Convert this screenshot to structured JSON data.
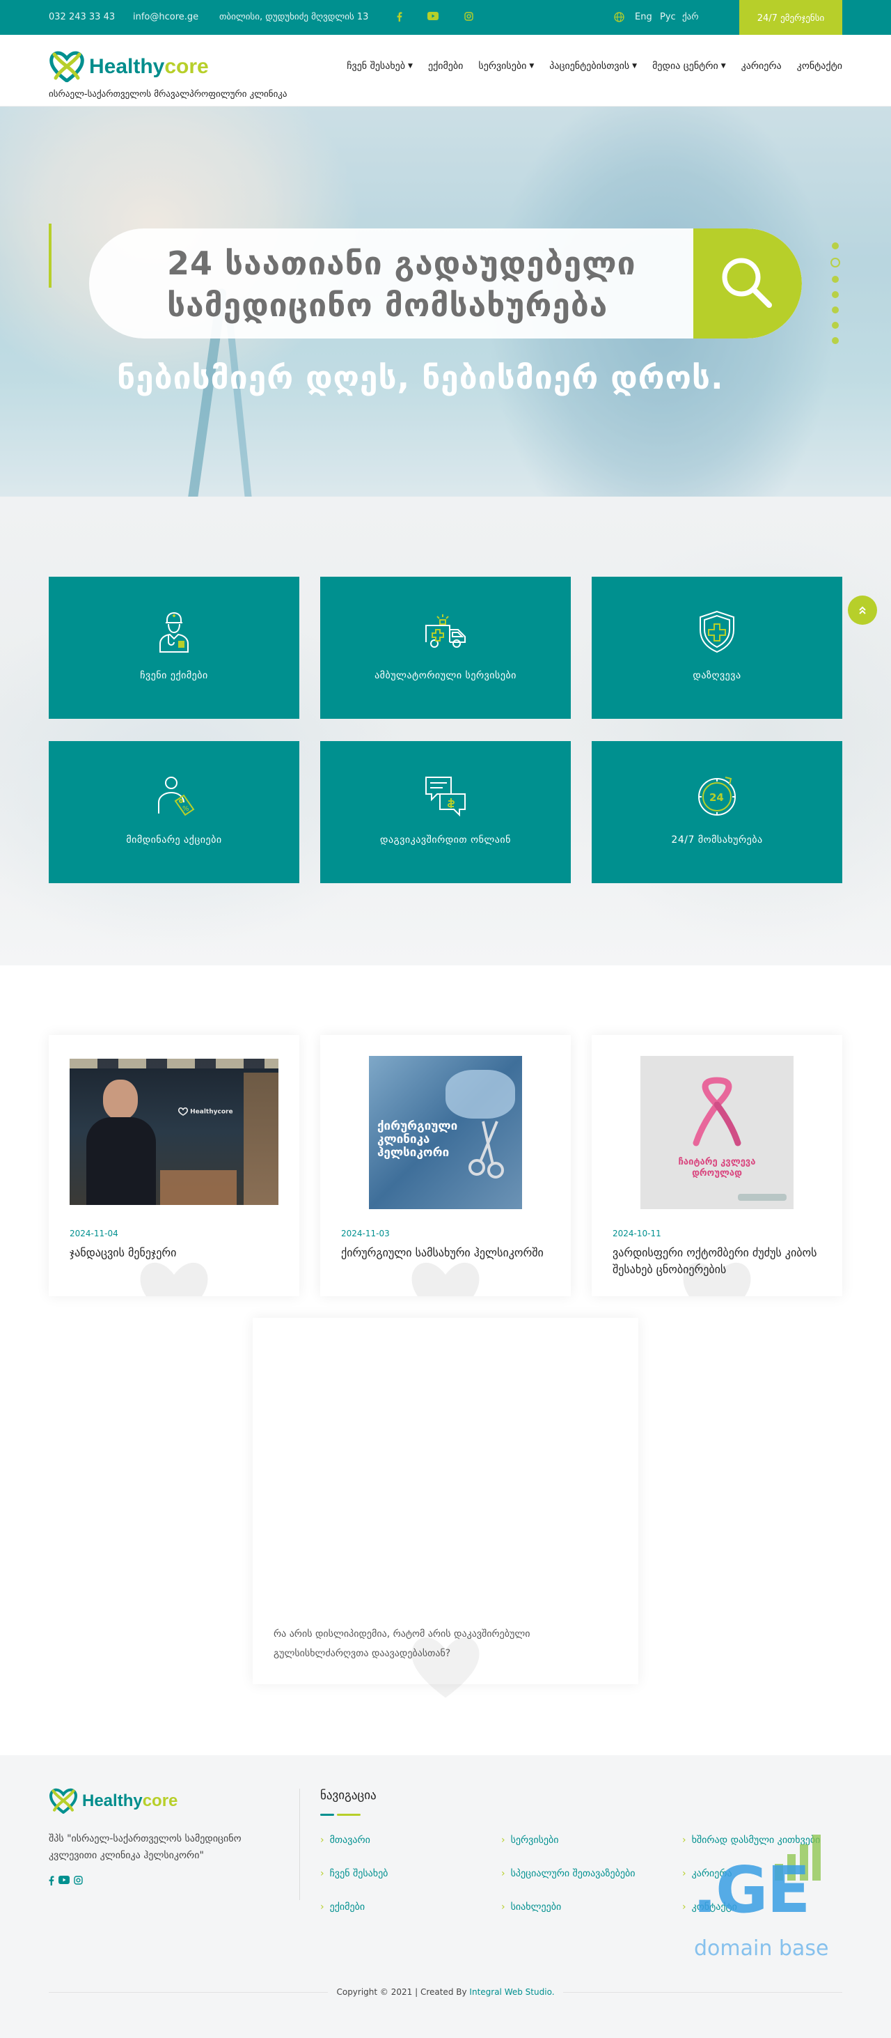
{
  "topbar": {
    "phone": "032 243 33 43",
    "email": "info@hcore.ge",
    "address": "თბილისი, დუდუხიძე მღვდლის 13",
    "languages": [
      "Eng",
      "Рус",
      "ქარ"
    ],
    "emergency_label": "24/7 ემერჯენსი"
  },
  "brand": {
    "name_part1": "Healthy",
    "name_part2": "core",
    "tagline": "ისრაელ-საქართველოს მრავალპროფილური კლინიკა"
  },
  "nav": {
    "items": [
      {
        "label": "ჩვენ შესახებ",
        "dropdown": true
      },
      {
        "label": "ექიმები",
        "dropdown": false
      },
      {
        "label": "სერვისები",
        "dropdown": true
      },
      {
        "label": "პაციენტებისთვის",
        "dropdown": true
      },
      {
        "label": "მედია ცენტრი",
        "dropdown": true
      },
      {
        "label": "კარიერა",
        "dropdown": false
      },
      {
        "label": "კონტაქტი",
        "dropdown": false
      }
    ]
  },
  "hero": {
    "search_text_line1": "24 საათიანი გადაუდებელი",
    "search_text_line2": "სამედიცინო მომსახურება",
    "slogan": "ნებისმიერ დღეს, ნებისმიერ დროს.",
    "slide_count": 8,
    "active_slide": 2
  },
  "services": {
    "cards": [
      {
        "label": "ჩვენი ექიმები",
        "icon": "doctor-icon"
      },
      {
        "label": "ამბულატორიული სერვისები",
        "icon": "ambulance-icon"
      },
      {
        "label": "დაზღვევა",
        "icon": "shield-cross-icon"
      },
      {
        "label": "მიმდინარე აქციები",
        "icon": "discount-tag-icon"
      },
      {
        "label": "დაგვიკავშირდით ონლაინ",
        "icon": "chat-bubbles-icon"
      },
      {
        "label": "24/7 მომსახურება",
        "icon": "clock-24-icon"
      }
    ]
  },
  "news": {
    "items": [
      {
        "date": "2024-11-04",
        "title": "ჯანდაცვის მენეჯერი"
      },
      {
        "date": "2024-11-03",
        "title": "ქირურგიული სამსახური ჰელსიკორში",
        "image_text": "ქირურგიული\nკლინიკა\nჰელსიკორი"
      },
      {
        "date": "2024-10-11",
        "title": "ვარდისფერი ოქტომბერი ძუძუს კიბოს შესახებ ცნობიერების",
        "image_text": "ჩაიტარე კვლევა\nდროულად"
      }
    ],
    "video_caption": "რა არის დისლიპიდემია, რატომ არის დაკავშირებული გულსისხლძარღვთა დაავადებასთან?"
  },
  "footer": {
    "about": "შპს \"ისრაელ-საქართველოს სამედიცინო კვლევითი კლინიკა ჰელსიკორი\"",
    "nav_heading": "ნავიგაცია",
    "links_col1": [
      "მთავარი",
      "ჩვენ შესახებ",
      "ექიმები"
    ],
    "links_col2": [
      "სერვისები",
      "სპეციალური შეთავაზებები",
      "სიახლეები"
    ],
    "links_col3": [
      "ხშირად დასმული კითხვები",
      "კარიერა",
      "კონტაქტი"
    ],
    "copyright": "Copyright © 2021 | Created By",
    "credit_link": "Integral Web Studio."
  },
  "watermark": {
    "mark": ".GE",
    "text": "domain base"
  },
  "colors": {
    "teal": "#00908f",
    "lime": "#b7cf2a"
  }
}
